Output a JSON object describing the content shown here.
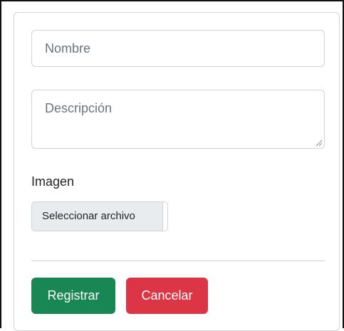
{
  "form": {
    "name_placeholder": "Nombre",
    "description_placeholder": "Descripción",
    "image_label": "Imagen",
    "file_button_label": "Seleccionar archivo",
    "submit_label": "Registrar",
    "cancel_label": "Cancelar"
  },
  "colors": {
    "submit_bg": "#198754",
    "cancel_bg": "#dc3545",
    "input_border": "#ced4da",
    "placeholder": "#6c757d"
  },
  "icons": {
    "resize_grip": "resize-grip-icon"
  }
}
